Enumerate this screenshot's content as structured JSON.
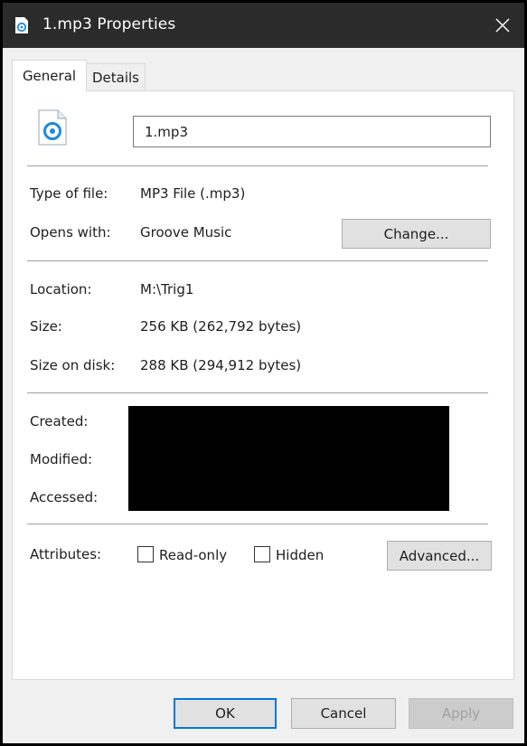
{
  "window": {
    "title": "1.mp3 Properties",
    "close_glyph": "✕"
  },
  "tabs": [
    {
      "label": "General",
      "selected": true
    },
    {
      "label": "Details",
      "selected": false
    }
  ],
  "general": {
    "file_icon": "groove-music-file-icon",
    "file_name": "1.mp3",
    "type_label": "Type of file:",
    "type_value": "MP3 File (.mp3)",
    "opens_label": "Opens with:",
    "opens_value": "Groove Music",
    "change_button": "Change...",
    "location_label": "Location:",
    "location_value": "M:\\Trig1",
    "size_label": "Size:",
    "size_value": "256 KB (262,792 bytes)",
    "size_on_disk_label": "Size on disk:",
    "size_on_disk_value": "288 KB (294,912 bytes)",
    "created_label": "Created:",
    "modified_label": "Modified:",
    "accessed_label": "Accessed:",
    "attributes_label": "Attributes:",
    "readonly_label": "Read-only",
    "hidden_label": "Hidden",
    "advanced_button": "Advanced..."
  },
  "footer": {
    "ok": "OK",
    "cancel": "Cancel",
    "apply": "Apply"
  },
  "colors": {
    "titlebar": "#2b2b2b",
    "accent": "#0078d7",
    "icon_blue": "#1e88e5"
  }
}
